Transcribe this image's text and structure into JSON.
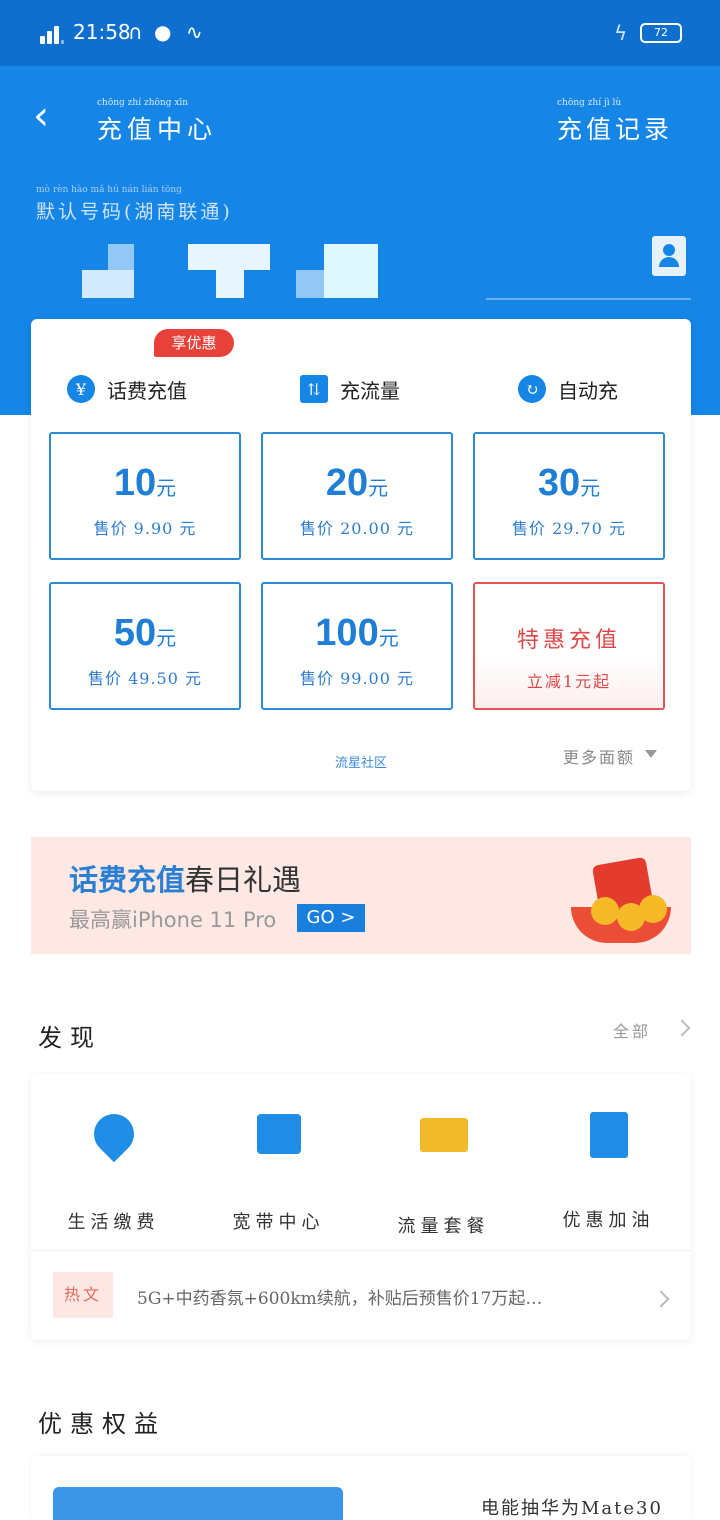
{
  "status": {
    "time": "21:58",
    "battery": "72",
    "icons": [
      "signal-icon",
      "headset-icon",
      "chat-bubble-icon",
      "wave-icon",
      "charging-icon"
    ]
  },
  "header": {
    "title": "充值中心",
    "title_pinyin": "chōng zhí zhōng xīn",
    "records": "充值记录",
    "records_pinyin": "chōng zhí jì lù"
  },
  "account": {
    "carrier": "默认号码(湖南联通)",
    "carrier_pinyin": "mò rèn hào mǎ   hú nán lián tōng"
  },
  "tabs": [
    {
      "label": "话费充值",
      "pinyin": "huà fèi chōng zhí",
      "icon": "yen-icon"
    },
    {
      "label": "充流量",
      "pinyin": "chōng liú liàng",
      "icon": "transfer-icon"
    },
    {
      "label": "自动充",
      "pinyin": "zì dòng chōng",
      "icon": "refresh-icon"
    }
  ],
  "promo_badge": "享优惠",
  "plans": [
    {
      "amount": "10",
      "unit": "元",
      "price": "售价 9.90 元"
    },
    {
      "amount": "20",
      "unit": "元",
      "price": "售价 20.00 元"
    },
    {
      "amount": "30",
      "unit": "元",
      "price": "售价 29.70 元"
    },
    {
      "amount": "50",
      "unit": "元",
      "price": "售价 49.50 元"
    },
    {
      "amount": "100",
      "unit": "元",
      "price": "售价 99.00 元"
    }
  ],
  "special": {
    "title": "特惠充值",
    "subtitle": "立减1元起"
  },
  "community": "流星社区",
  "more_amounts": "更多面额",
  "banner": {
    "highlight": "话费充值",
    "headline": "春日礼遇",
    "sub": "最高赢iPhone 11 Pro",
    "go": "GO >"
  },
  "discover": {
    "heading": "发现",
    "see_all": "全部",
    "items": [
      {
        "label": "生活缴费",
        "icon": "water-drop-icon"
      },
      {
        "label": "宽带中心",
        "icon": "storefront-icon"
      },
      {
        "label": "流量套餐",
        "icon": "card-icon"
      },
      {
        "label": "优惠加油",
        "icon": "gas-station-icon"
      }
    ],
    "hot_tag": "热文",
    "news": "5G+中药香氛+600km续航，补贴后预售价17万起…"
  },
  "benefits": {
    "heading": "优惠权益",
    "item": "电能抽华为Mate30"
  },
  "colors": {
    "primary": "#1585e6",
    "status_bar": "#0f6fcf",
    "special": "#e04848",
    "banner_bg": "#fde8e3"
  }
}
